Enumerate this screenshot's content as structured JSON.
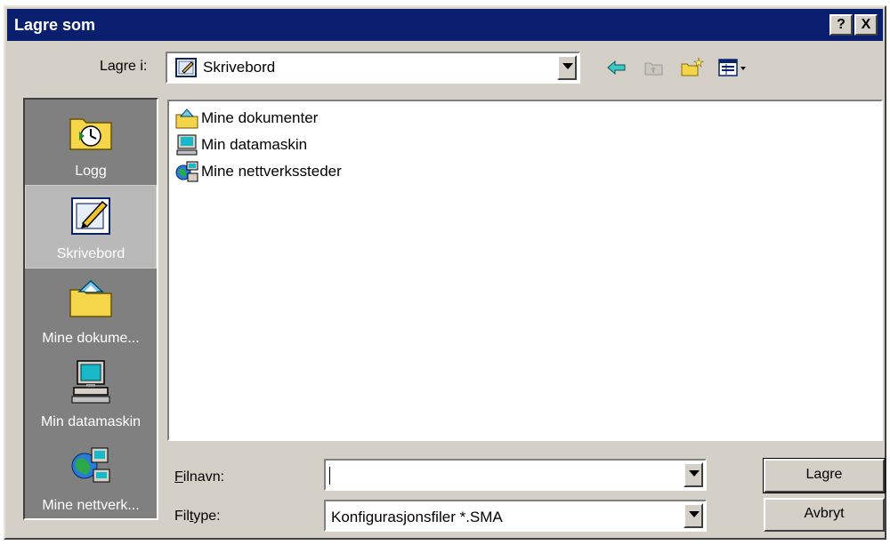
{
  "window": {
    "title": "Lagre som",
    "help_button": "?",
    "close_button": "X"
  },
  "toolbar": {
    "lagre_i_prefix": "La",
    "lagre_i_hotkey": "g",
    "lagre_i_suffix": "re i:",
    "location_value": "Skrivebord",
    "icons": [
      "back-icon",
      "up-folder-icon",
      "new-folder-icon",
      "view-menu-icon"
    ]
  },
  "places": [
    {
      "label": "Logg",
      "icon": "history-folder-icon",
      "selected": false
    },
    {
      "label": "Skrivebord",
      "icon": "desktop-icon",
      "selected": true
    },
    {
      "label": "Mine dokume...",
      "icon": "my-documents-icon",
      "selected": false
    },
    {
      "label": "Min datamaskin",
      "icon": "my-computer-icon",
      "selected": false
    },
    {
      "label": "Mine nettverk...",
      "icon": "network-places-icon",
      "selected": false
    }
  ],
  "files": [
    {
      "name": "Mine dokumenter",
      "icon": "my-documents-icon"
    },
    {
      "name": "Min datamaskin",
      "icon": "my-computer-icon"
    },
    {
      "name": "Mine nettverkssteder",
      "icon": "network-places-icon"
    }
  ],
  "form": {
    "filename_hotkey": "F",
    "filename_label_rest": "ilnavn:",
    "filename_value": "",
    "filetype_prefix": "Fil",
    "filetype_hotkey": "t",
    "filetype_suffix": "ype:",
    "filetype_value": "Konfigurasjonsfiler *.SMA"
  },
  "buttons": {
    "save": "Lagre",
    "cancel": "Avbryt"
  }
}
